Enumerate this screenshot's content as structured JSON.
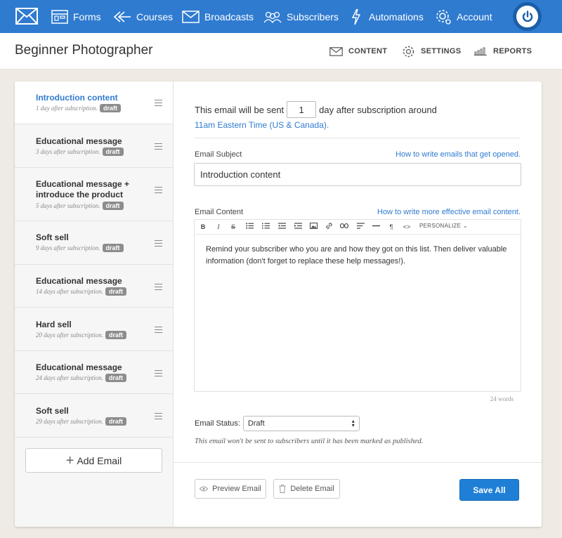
{
  "nav": {
    "items": [
      {
        "label": "Forms",
        "icon": "forms-icon"
      },
      {
        "label": "Courses",
        "icon": "courses-icon"
      },
      {
        "label": "Broadcasts",
        "icon": "broadcasts-icon"
      },
      {
        "label": "Subscribers",
        "icon": "subscribers-icon"
      },
      {
        "label": "Automations",
        "icon": "automations-icon"
      },
      {
        "label": "Account",
        "icon": "account-gear-icon"
      }
    ],
    "colors": {
      "bar": "#2f7bd0",
      "power": "#1b5fa8"
    }
  },
  "header": {
    "title": "Beginner Photographer",
    "tabs": [
      {
        "label": "CONTENT",
        "icon": "envelope-icon"
      },
      {
        "label": "SETTINGS",
        "icon": "gear-icon"
      },
      {
        "label": "REPORTS",
        "icon": "bar-chart-icon"
      }
    ]
  },
  "sidebar": {
    "items": [
      {
        "title": "Introduction content",
        "subtitle": "1 day after subscription.",
        "badge": "draft"
      },
      {
        "title": "Educational message",
        "subtitle": "3 days after subscription.",
        "badge": "draft"
      },
      {
        "title": "Educational message + introduce the product",
        "subtitle": "5 days after subscription.",
        "badge": "draft"
      },
      {
        "title": "Soft sell",
        "subtitle": "9 days after subscription.",
        "badge": "draft"
      },
      {
        "title": "Educational message",
        "subtitle": "14 days after subscription.",
        "badge": "draft"
      },
      {
        "title": "Hard sell",
        "subtitle": "20 days after subscription.",
        "badge": "draft"
      },
      {
        "title": "Educational message",
        "subtitle": "24 days after subscription.",
        "badge": "draft"
      },
      {
        "title": "Soft sell",
        "subtitle": "29 days after subscription.",
        "badge": "draft"
      }
    ],
    "add_label": "Add Email"
  },
  "main": {
    "sent_prefix": "This email will be sent",
    "sent_days": "1",
    "sent_suffix": "day after subscription around",
    "time_link": "11am Eastern Time (US & Canada).",
    "subject_label": "Email Subject",
    "subject_help": "How to write emails that get opened.",
    "subject_value": "Introduction content",
    "content_label": "Email Content",
    "content_help": "How to write more effective email content.",
    "toolbar": {
      "bold": "B",
      "italic": "I",
      "strike": "S",
      "personalize": "PERSONALIZE"
    },
    "body": "Remind your subscriber who you are and how they got on this list. Then deliver valuable information (don't forget to replace these help messages!).",
    "word_count": "24 words",
    "status_label": "Email Status:",
    "status_value": "Draft",
    "status_note": "This email won't be sent to subscribers until it has been marked as published.",
    "preview_label": "Preview Email",
    "delete_label": "Delete Email",
    "save_label": "Save All"
  }
}
